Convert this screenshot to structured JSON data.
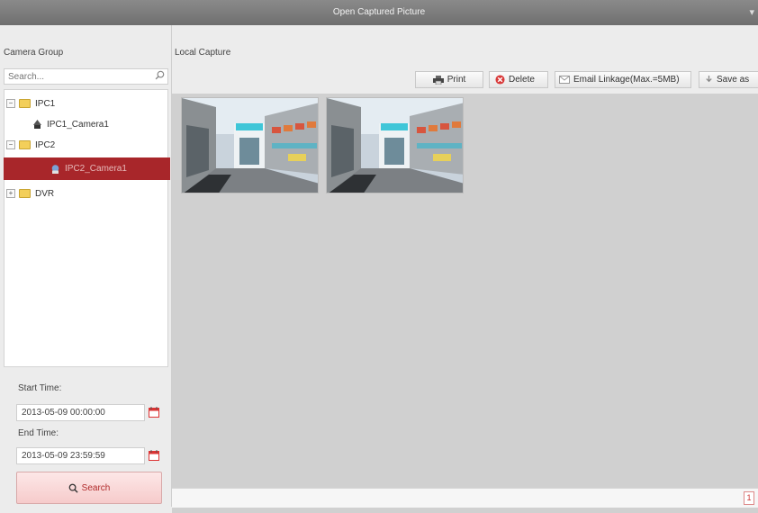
{
  "window": {
    "title": "Open Captured Picture",
    "close_glyph": "▾"
  },
  "sidebar": {
    "group_label": "Camera Group",
    "search_placeholder": "Search...",
    "tree": [
      {
        "label": "IPC1",
        "type": "folder",
        "expander": "−"
      },
      {
        "label": "IPC1_Camera1",
        "type": "camera"
      },
      {
        "label": "IPC2",
        "type": "folder",
        "expander": "−"
      },
      {
        "label": "IPC2_Camera1",
        "type": "camera",
        "selected": true
      },
      {
        "label": "DVR",
        "type": "folder",
        "expander": "+"
      }
    ],
    "start_time_label": "Start Time:",
    "start_time_value": "2013-05-09 00:00:00",
    "end_time_label": "End Time:",
    "end_time_value": "2013-05-09 23:59:59",
    "search_button": "Search"
  },
  "main": {
    "section_label": "Local Capture",
    "toolbar": {
      "print": "Print",
      "delete": "Delete",
      "email": "Email Linkage(Max.=5MB)",
      "save_as": "Save as"
    },
    "thumbnails": [
      "captured-picture-1",
      "captured-picture-2"
    ],
    "page_number": "1"
  },
  "colors": {
    "titlebar": "#7a7a7a",
    "selected": "#a8262a",
    "accent_red": "#d93a3a",
    "search_button": "#f6cbcb"
  }
}
